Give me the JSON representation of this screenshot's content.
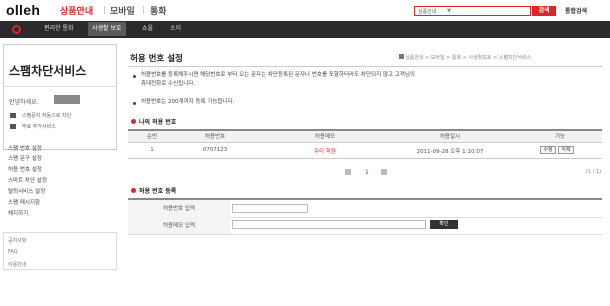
{
  "header": {
    "logo": "olleh",
    "nav": [
      "상품안내",
      "모바일",
      "통화"
    ],
    "search_placeholder": "상품안내",
    "search_label": "검색",
    "total_service": "통합검색"
  },
  "dark_nav": [
    "편리한 통화",
    "사생활 보호",
    "쇼올",
    "소이"
  ],
  "left_panel": {
    "title": "스팸차단서비스",
    "greeting": "안녕하세요.",
    "services": [
      "스팸문자 자동으로 차단",
      "무료 부가서비스"
    ],
    "menu": [
      "스팸 번호 설정",
      "스팸 문구 설정",
      "허용 번호 설정",
      "스마트 차단 설정",
      "탈퇴서비스 설정",
      "스팸 메시지함",
      "해지하기"
    ],
    "sub": [
      "공지사항",
      "FAQ",
      "이용안내"
    ]
  },
  "main": {
    "title": "허용 번호 설정",
    "breadcrumb": "상품안내 > 모바일 > 통화 > 사생활보호 > 스팸차단서비스",
    "notice": [
      "허용번호를 등록해주시면 해당번호로 부터 오는 문자는 차단등록된 문자나 번호를 포함하더라도 차단되지 않고 고객님의",
      "휴대전화로 수신됩니다.",
      "허용번호는 200개까지 등록 가능합니다."
    ],
    "my_numbers_title": "나의 허용 번호",
    "table": {
      "headers": [
        "순번",
        "허용번호",
        "허용메모",
        "허용일시",
        "기능"
      ],
      "rows": [
        {
          "no": "1",
          "number": "0707123",
          "memo": "우리 학원",
          "datetime": "2011-09-28 오후 1:10:07",
          "edit": "수정",
          "delete": "삭제"
        }
      ]
    },
    "pagination": {
      "current": "1",
      "count": "(1 / 1)"
    },
    "register_title": "허용 번호 등록",
    "form": {
      "number_label": "허용번호 입력",
      "memo_label": "허용메모 입력",
      "confirm": "확인"
    }
  }
}
